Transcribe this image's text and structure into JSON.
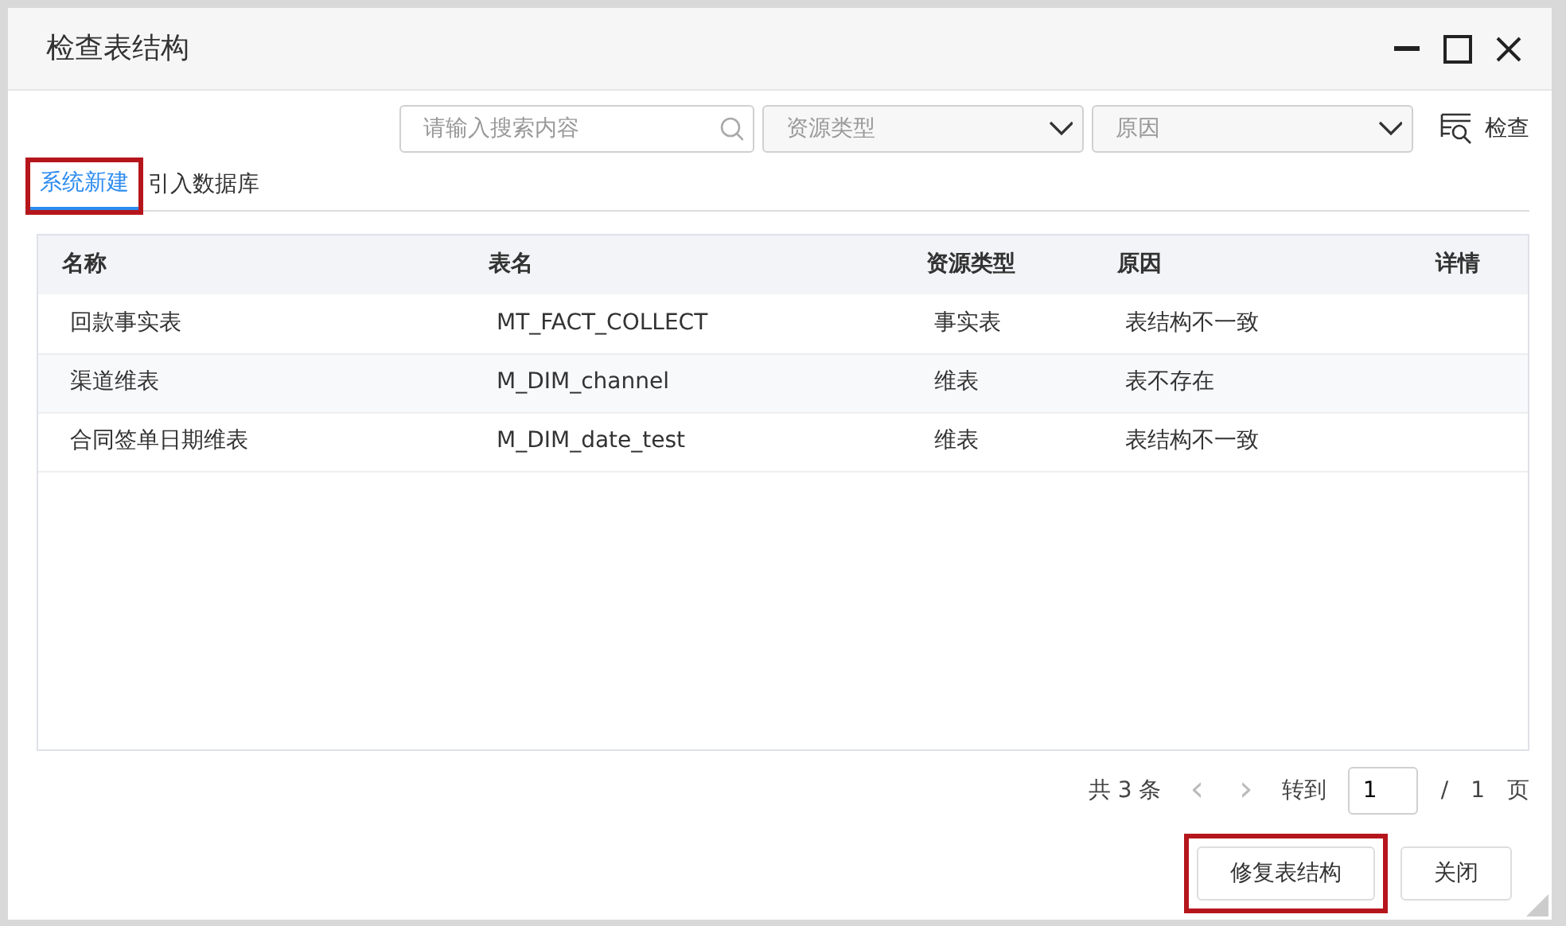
{
  "window": {
    "title": "检查表结构"
  },
  "toolbar": {
    "search": {
      "placeholder": "请输入搜索内容"
    },
    "filters": [
      {
        "placeholder": "资源类型"
      },
      {
        "placeholder": "原因"
      }
    ],
    "check_button": "检查"
  },
  "tabs": [
    {
      "label": "系统新建",
      "selected": true,
      "highlighted": true
    },
    {
      "label": "引入数据库",
      "selected": false,
      "highlighted": false
    }
  ],
  "table": {
    "columns": [
      "名称",
      "表名",
      "资源类型",
      "原因",
      "详情"
    ],
    "rows": [
      [
        "回款事实表",
        "MT_FACT_COLLECT",
        "事实表",
        "表结构不一致"
      ],
      [
        "渠道维表",
        "M_DIM_channel",
        "维表",
        "表不存在"
      ],
      [
        "合同签单日期维表",
        "M_DIM_date_test",
        "维表",
        "表结构不一致"
      ]
    ]
  },
  "pagination": {
    "total": "共 3 条",
    "prev": "‹",
    "next": "›",
    "goto": "转到",
    "page": "1",
    "separator": "/",
    "pages": "1",
    "unit": "页"
  },
  "buttons": [
    {
      "label": "修复表结构",
      "highlighted": true
    },
    {
      "label": "关闭",
      "highlighted": false
    }
  ]
}
